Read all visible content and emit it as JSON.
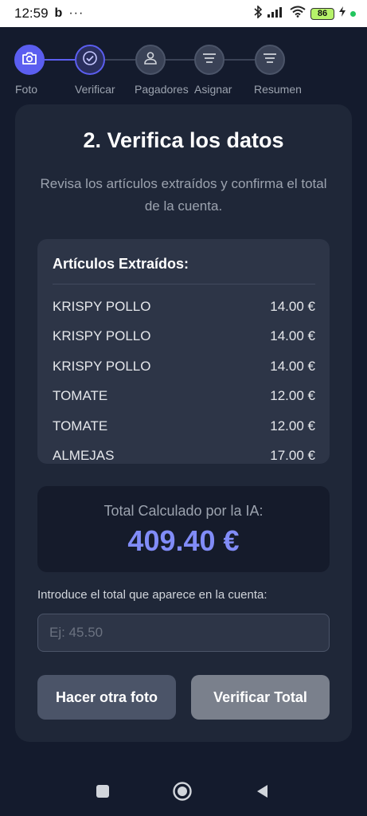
{
  "status_bar": {
    "time": "12:59",
    "app_icon": "b",
    "dots": "···",
    "battery": "86"
  },
  "stepper": {
    "steps": [
      {
        "label": "Foto",
        "icon": "camera-icon",
        "state": "done"
      },
      {
        "label": "Verificar",
        "icon": "check-circle-icon",
        "state": "current"
      },
      {
        "label": "Pagadores",
        "icon": "user-icon",
        "state": "pending"
      },
      {
        "label": "Asignar",
        "icon": "list-icon",
        "state": "pending"
      },
      {
        "label": "Resumen",
        "icon": "list-icon",
        "state": "pending"
      }
    ]
  },
  "card": {
    "title": "2. Verifica los datos",
    "description": "Revisa los artículos extraídos y confirma el total de la cuenta."
  },
  "items": {
    "header": "Artículos Extraídos:",
    "rows": [
      {
        "name": "KRISPY POLLO",
        "price": "14.00 €"
      },
      {
        "name": "KRISPY POLLO",
        "price": "14.00 €"
      },
      {
        "name": "KRISPY POLLO",
        "price": "14.00 €"
      },
      {
        "name": "TOMATE",
        "price": "12.00 €"
      },
      {
        "name": "TOMATE",
        "price": "12.00 €"
      },
      {
        "name": "ALMEJAS",
        "price": "17.00 €"
      }
    ]
  },
  "total": {
    "label": "Total Calculado por la IA:",
    "value": "409.40 €"
  },
  "input": {
    "label": "Introduce el total que aparece en la cuenta:",
    "placeholder": "Ej: 45.50",
    "value": ""
  },
  "buttons": {
    "retake": "Hacer otra foto",
    "verify": "Verificar Total"
  },
  "colors": {
    "accent": "#5b5ef0",
    "total_value": "#818cf8",
    "background": "#141b2d",
    "card": "#1f2738"
  }
}
